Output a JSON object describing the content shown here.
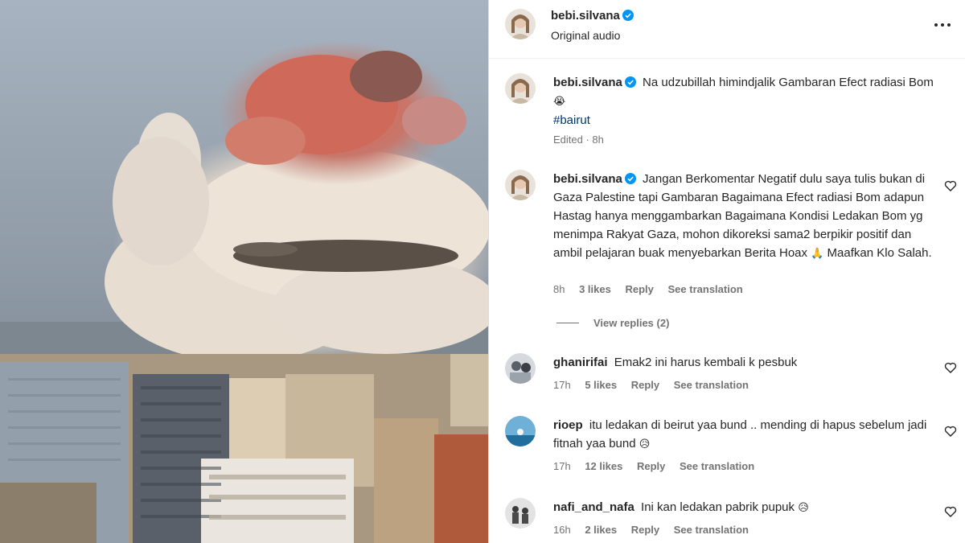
{
  "post": {
    "username": "bebi.silvana",
    "audio": "Original audio"
  },
  "caption": {
    "username": "bebi.silvana",
    "text": "Na udzubillah himindjalik Gambaran Efect radiasi Bom",
    "emoji": "😭",
    "hashtag": "#bairut",
    "edited": "Edited · 8h"
  },
  "comments": [
    {
      "username": "bebi.silvana",
      "text": "Jangan Berkomentar Negatif dulu saya tulis bukan di Gaza Palestine tapi Gambaran Bagaimana Efect radiasi Bom adapun Hastag hanya menggambarkan Bagaimana Kondisi Ledakan Bom yg menimpa Rakyat Gaza, mohon dikoreksi sama2 berpikir positif dan ambil pelajaran buak menyebarkan Berita Hoax",
      "emoji": "🙏",
      "text2": "Maafkan Klo Salah.",
      "time": "8h",
      "likes": "3 likes",
      "reply": "Reply",
      "translate": "See translation",
      "view_replies": "View replies (2)"
    },
    {
      "username": "ghanirifai",
      "text": "Emak2 ini harus kembali k pesbuk",
      "time": "17h",
      "likes": "5 likes",
      "reply": "Reply",
      "translate": "See translation"
    },
    {
      "username": "rioep",
      "text": "itu ledakan di beirut yaa bund .. mending di hapus sebelum jadi fitnah yaa bund",
      "emoji": "😥",
      "time": "17h",
      "likes": "12 likes",
      "reply": "Reply",
      "translate": "See translation"
    },
    {
      "username": "nafi_and_nafa",
      "text": "Ini kan ledakan pabrik pupuk",
      "emoji": "😥",
      "time": "16h",
      "likes": "2 likes",
      "reply": "Reply",
      "translate": "See translation"
    }
  ],
  "icons": {
    "verified": "verified-badge-icon",
    "more": "more-options-icon",
    "like": "heart-icon"
  },
  "colors": {
    "verified": "#0095f6",
    "link": "#00376b",
    "secondary": "#737373"
  }
}
